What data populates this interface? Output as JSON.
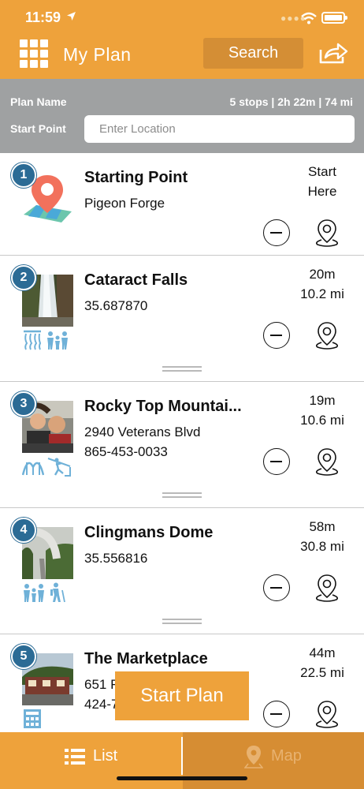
{
  "status": {
    "time": "11:59"
  },
  "header": {
    "title": "My Plan",
    "search_label": "Search"
  },
  "plan": {
    "name_label": "Plan Name",
    "summary": "5 stops | 2h 22m | 74 mi",
    "start_label": "Start Point",
    "start_placeholder": "Enter Location"
  },
  "stops": [
    {
      "num": "1",
      "name": "Starting Point",
      "line1": "Pigeon Forge",
      "line2": "",
      "time": "Start",
      "dist": "Here"
    },
    {
      "num": "2",
      "name": "Cataract Falls",
      "line1": "35.687870",
      "line2": "",
      "time": "20m",
      "dist": "10.2 mi"
    },
    {
      "num": "3",
      "name": "Rocky Top Mountai...",
      "line1": "2940 Veterans Blvd",
      "line2": "865-453-0033",
      "time": "19m",
      "dist": "10.6 mi"
    },
    {
      "num": "4",
      "name": "Clingmans Dome",
      "line1": "35.556816",
      "line2": "",
      "time": "58m",
      "dist": "30.8 mi"
    },
    {
      "num": "5",
      "name": "The Marketplace",
      "line1": "651 F",
      "line2": "424-7",
      "time": "44m",
      "dist": "22.5 mi"
    }
  ],
  "start_plan_label": "Start Plan",
  "tabs": {
    "list_label": "List",
    "map_label": "Map"
  },
  "colors": {
    "brand_orange": "#eea23b",
    "plan_bar_gray": "#9fa1a2",
    "stop_badge_blue": "#2b6b95",
    "category_blue": "#6fb1d8"
  }
}
